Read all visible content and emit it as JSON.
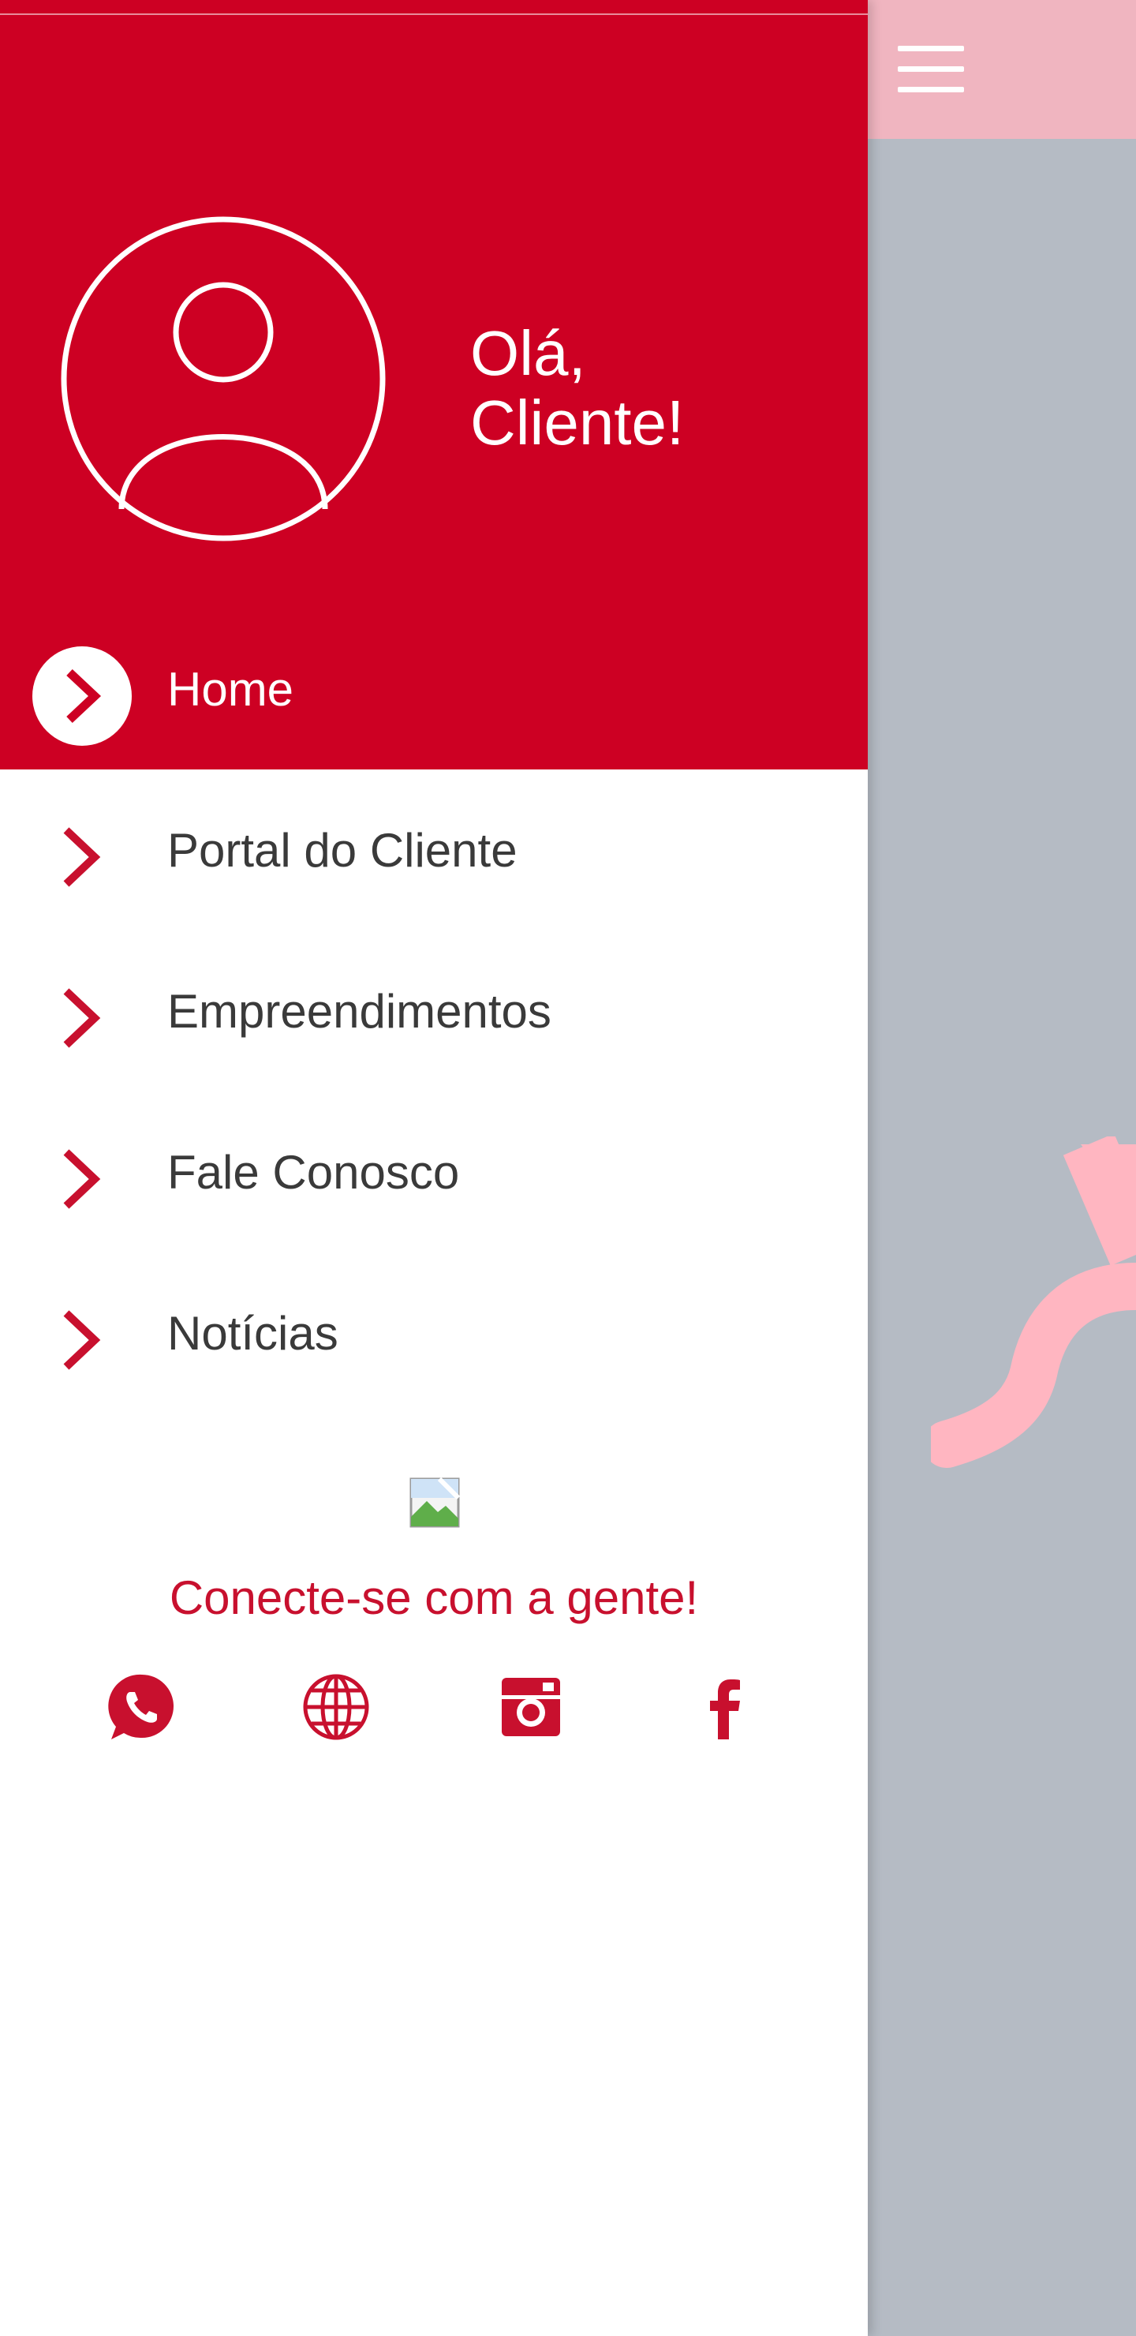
{
  "greeting": {
    "line1": "Olá,",
    "line2": "Cliente!"
  },
  "menu": {
    "items": [
      {
        "label": "Home",
        "active": true
      },
      {
        "label": "Portal do Cliente",
        "active": false
      },
      {
        "label": "Empreendimentos",
        "active": false
      },
      {
        "label": "Fale Conosco",
        "active": false
      },
      {
        "label": "Notícias",
        "active": false
      }
    ]
  },
  "footer": {
    "connect_text": "Conecte-se com a gente!",
    "social_icons": [
      "whatsapp-icon",
      "globe-icon",
      "instagram-icon",
      "facebook-icon"
    ]
  },
  "colors": {
    "brand_red": "#cd0023",
    "accent_red": "#c8102e",
    "overlay": "#b5bbc4",
    "topbar_dimmed": "#f0b5c0",
    "logo_dimmed": "#ffb6c1"
  }
}
